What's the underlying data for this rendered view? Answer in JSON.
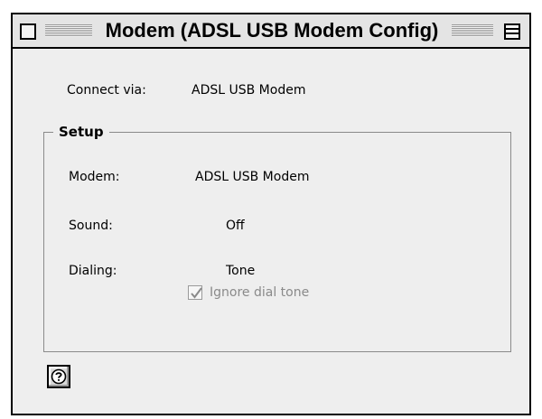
{
  "window": {
    "title": "Modem (ADSL USB Modem Config)"
  },
  "connect": {
    "label": "Connect via:",
    "value": "ADSL USB Modem"
  },
  "setup": {
    "title": "Setup",
    "modem_label": "Modem:",
    "modem_value": "ADSL USB Modem",
    "sound_label": "Sound:",
    "sound_value": "Off",
    "dialing_label": "Dialing:",
    "dialing_value": "Tone",
    "ignore_dial_tone": {
      "label": "Ignore dial tone",
      "checked": true,
      "enabled": false
    }
  },
  "icons": {
    "help": "help-icon",
    "close": "close-box-icon",
    "zoom": "zoom-box-icon",
    "checkmark": "checkmark-icon"
  }
}
